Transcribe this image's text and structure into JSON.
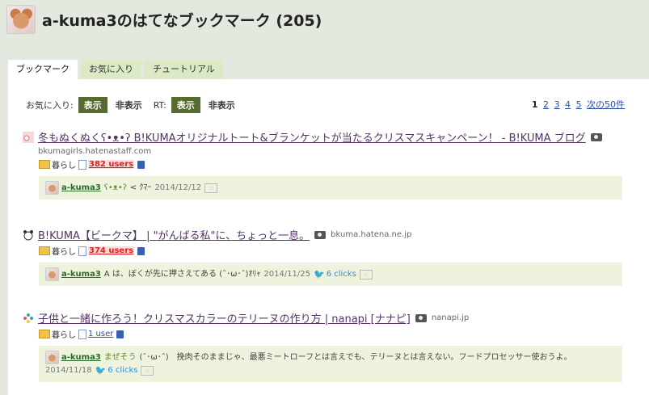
{
  "header": {
    "title": "a-kuma3のはてなブックマーク (205)"
  },
  "tabs": [
    {
      "label": "ブックマーク",
      "active": true
    },
    {
      "label": "お気に入り"
    },
    {
      "label": "チュートリアル"
    }
  ],
  "filters": {
    "fav_label": "お気に入り:",
    "show": "表示",
    "hide": "非表示",
    "rt_label": "RT:"
  },
  "pager": {
    "current": "1",
    "pages": [
      "2",
      "3",
      "4",
      "5"
    ],
    "next": "次の50件"
  },
  "entries": [
    {
      "title": "冬もぬくぬくʕ•ᴥ•ʔ B!KUMAオリジナルトート&ブランケットが当たるクリスマスキャンペーン！ - B!KUMA ブログ",
      "domain": "bkumagirls.hatenastaff.com",
      "tag": "暮らし",
      "users": "382 users",
      "comment": {
        "user": "a-kuma3",
        "tag": "ʕ•ᴥ•ʔ",
        "text": "< ｸﾏｰ",
        "time": "2014/12/12"
      }
    },
    {
      "title": "B!KUMA【ビークマ】 | \"がんばる私\"に、ちょっと一息。",
      "domain": "bkuma.hatena.ne.jp",
      "tag": "暮らし",
      "users": "374 users",
      "comment": {
        "user": "a-kuma3",
        "text": "A は、ぼくが先に押さえてある (ˆ･ω･ˆ)ｵﾘｬ",
        "time": "2014/11/25",
        "clicks": "6 clicks"
      }
    },
    {
      "title": "子供と一緒に作ろう！クリスマスカラーのテリーヌの作り方 | nanapi [ナナピ]",
      "domain": "nanapi.jp",
      "tag": "暮らし",
      "users": "1 user",
      "comment": {
        "user": "a-kuma3",
        "tag": "まぜそう",
        "text": "(ˆ･ω･ˆ)　挽肉そのままじゃ、最悪ミートローフとは言えでも、テリーヌとは言えない。フードプロセッサー使おうよ。",
        "time": "2014/11/18",
        "clicks": "6 clicks"
      }
    }
  ],
  "colors": {
    "accent": "#556b2f",
    "hot": "#e02020",
    "link": "#2a4fa0"
  }
}
